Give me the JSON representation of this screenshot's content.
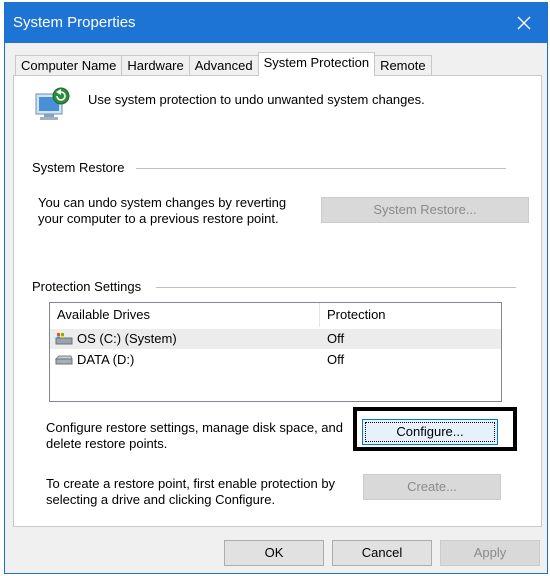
{
  "window": {
    "title": "System Properties"
  },
  "tabs": [
    {
      "label": "Computer Name"
    },
    {
      "label": "Hardware"
    },
    {
      "label": "Advanced"
    },
    {
      "label": "System Protection"
    },
    {
      "label": "Remote"
    }
  ],
  "intro": {
    "text": "Use system protection to undo unwanted system changes."
  },
  "system_restore": {
    "title": "System Restore",
    "description_line1": "You can undo system changes by reverting",
    "description_line2": "your computer to a previous restore point.",
    "button": "System Restore..."
  },
  "protection_settings": {
    "title": "Protection Settings",
    "columns": [
      "Available Drives",
      "Protection"
    ],
    "drives": [
      {
        "name": "OS (C:) (System)",
        "protection": "Off",
        "icon": "system-drive-icon"
      },
      {
        "name": "DATA (D:)",
        "protection": "Off",
        "icon": "drive-icon"
      }
    ],
    "configure_text_line1": "Configure restore settings, manage disk space, and",
    "configure_text_line2": "delete restore points.",
    "configure_button": "Configure...",
    "create_text_line1": "To create a restore point, first enable protection by",
    "create_text_line2": "selecting a drive and clicking Configure.",
    "create_button": "Create..."
  },
  "footer": {
    "ok": "OK",
    "cancel": "Cancel",
    "apply": "Apply"
  },
  "colors": {
    "titlebar": "#1e74d4",
    "highlight": "#000000",
    "focus": "#0078d7"
  }
}
